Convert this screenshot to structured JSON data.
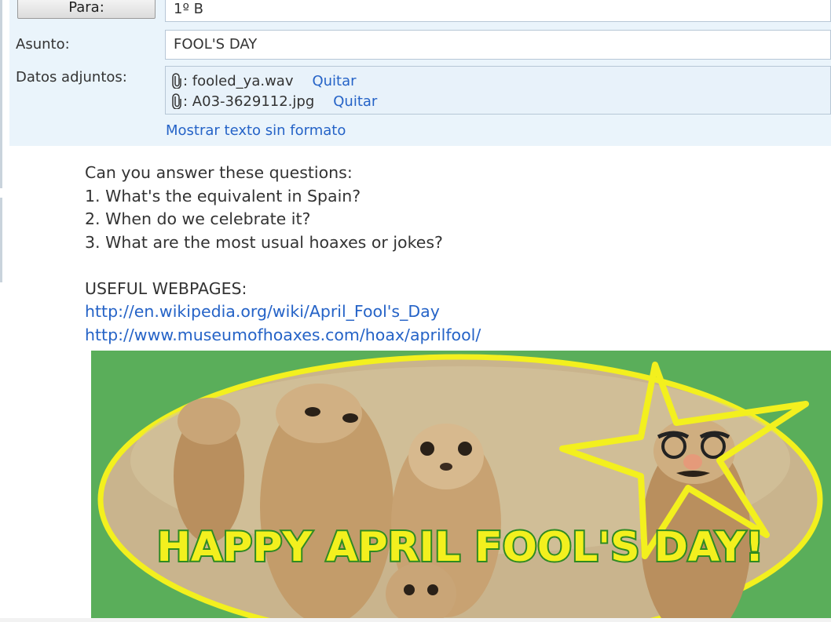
{
  "header": {
    "to_button_label": "Para:",
    "to_value": "1º B",
    "subject_label": "Asunto:",
    "subject_value": "FOOL'S DAY",
    "attachments_label": "Datos adjuntos:",
    "attachments": [
      {
        "filename": "fooled_ya.wav",
        "remove_label": "Quitar"
      },
      {
        "filename": "A03-3629112.jpg",
        "remove_label": "Quitar"
      }
    ],
    "plain_text_link": "Mostrar texto sin formato"
  },
  "body": {
    "lines": [
      "Can you answer these questions:",
      "1. What's the equivalent in Spain?",
      "2. When do we celebrate it?",
      "3. What are the most usual hoaxes or jokes?"
    ],
    "useful_heading": "USEFUL WEBPAGES:",
    "links": [
      "http://en.wikipedia.org/wiki/April_Fool's_Day",
      "http://www.museumofhoaxes.com/hoax/aprilfool/"
    ]
  },
  "image": {
    "caption_text": "HAPPY APRIL FOOL'S DAY!",
    "colors": {
      "background": "#5aae5a",
      "ring": "#f3f01e",
      "text_fill": "#f3f01e",
      "text_stroke": "#2f8a22",
      "fur": "#c8a577"
    }
  }
}
